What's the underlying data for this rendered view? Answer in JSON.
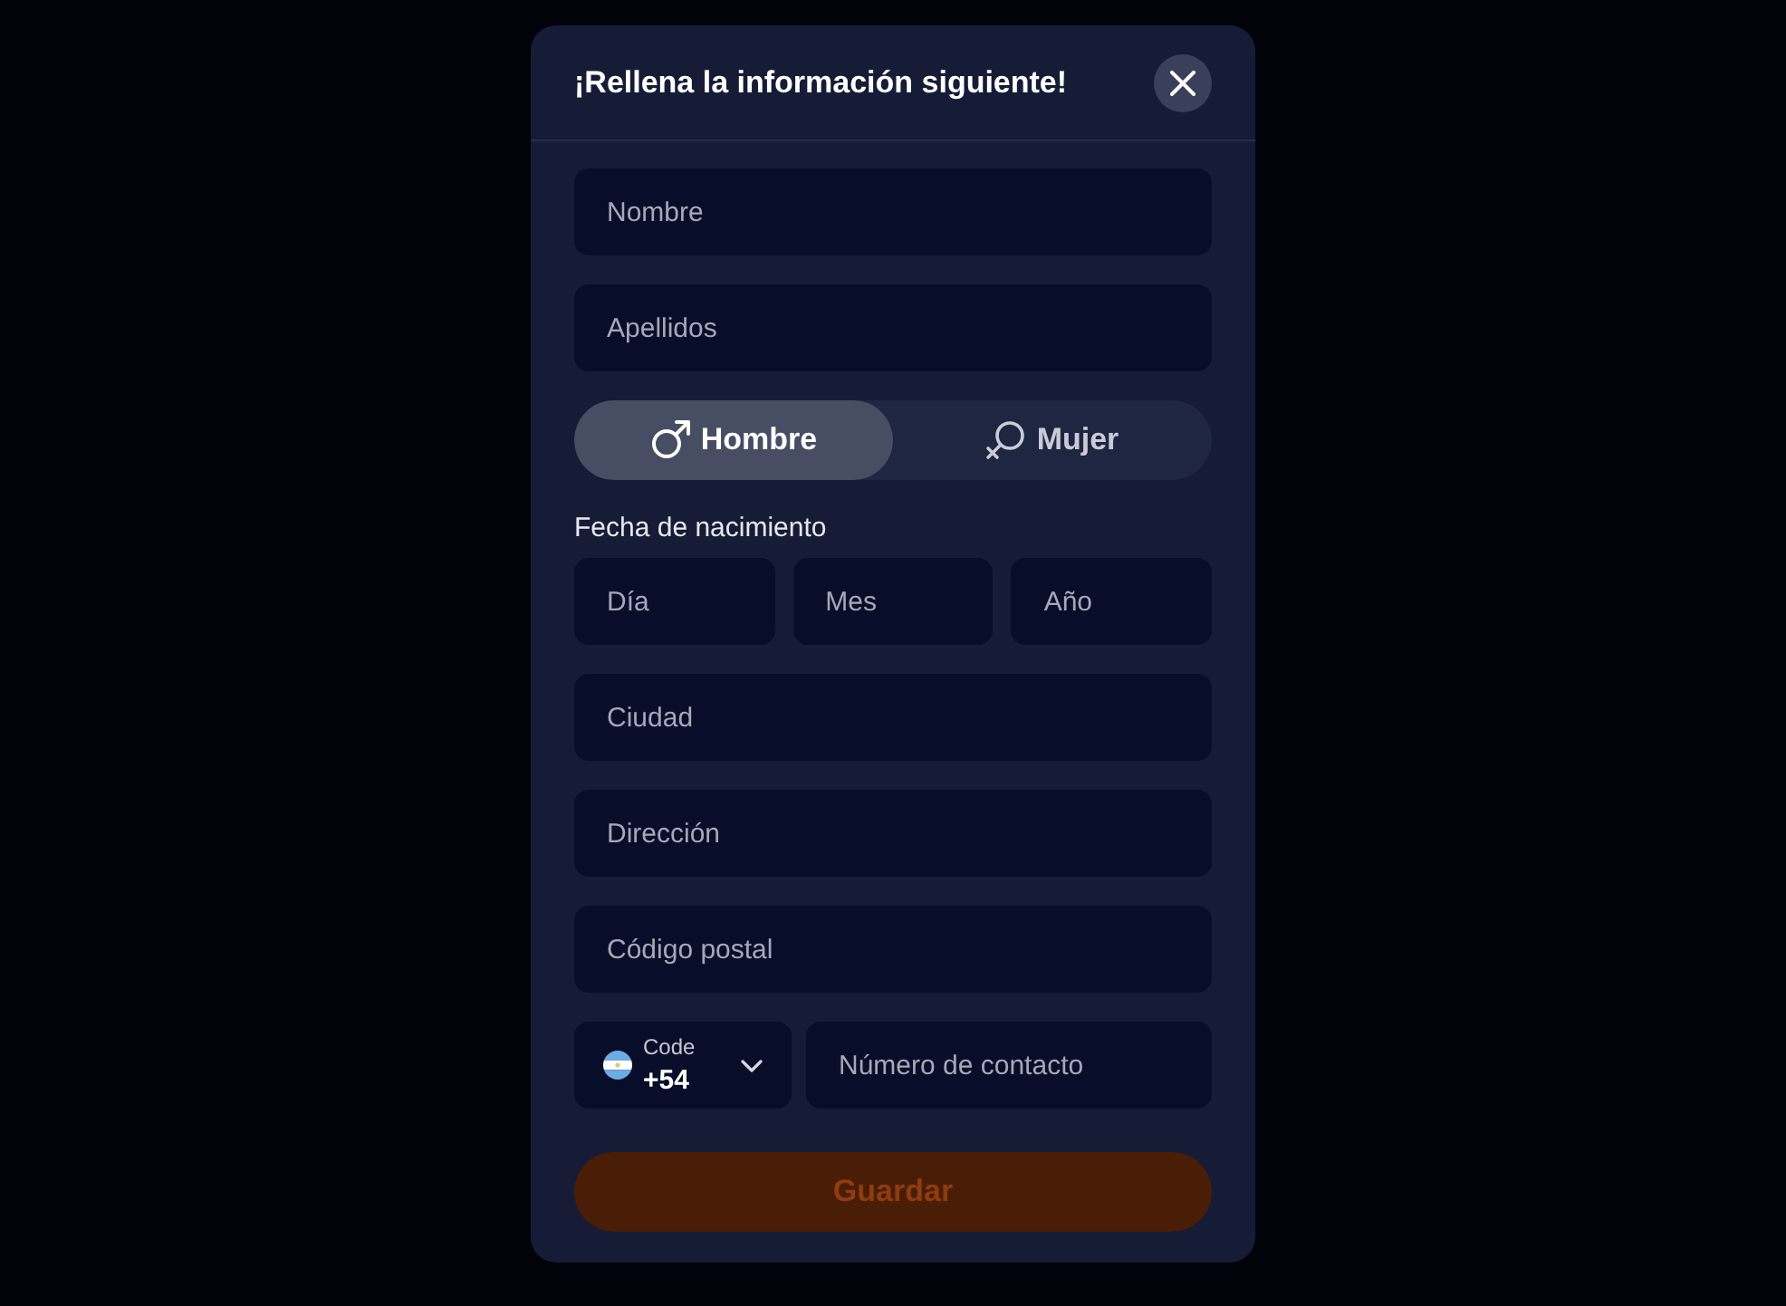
{
  "dialog": {
    "title": "¡Rellena la información siguiente!"
  },
  "fields_top": [
    {
      "placeholder": "Nombre"
    },
    {
      "placeholder": "Apellidos"
    }
  ],
  "gender": [
    {
      "kind": "male",
      "label": "Hombre",
      "selected": true
    },
    {
      "kind": "female",
      "label": "Mujer",
      "selected": false
    }
  ],
  "birth_date": {
    "label": "Fecha de nacimiento",
    "fields": [
      {
        "placeholder": "Día"
      },
      {
        "placeholder": "Mes"
      },
      {
        "placeholder": "Año"
      }
    ]
  },
  "fields_bottom": [
    {
      "placeholder": "Ciudad"
    },
    {
      "placeholder": "Dirección"
    },
    {
      "placeholder": "Código postal"
    }
  ],
  "phone": {
    "code_label": "Code",
    "code_value": "+54",
    "placeholder": "Número de contacto"
  },
  "submit": {
    "label": "Guardar",
    "disabled": true
  }
}
